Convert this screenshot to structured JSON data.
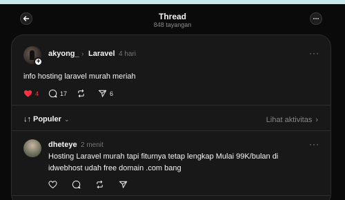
{
  "header": {
    "title": "Thread",
    "views": "848 tayangan",
    "back_icon": "arrow-left-icon",
    "more_icon": "more-horizontal-icon"
  },
  "post": {
    "username": "akyong_",
    "community": "Laravel",
    "time": "4 hari",
    "text": "info hosting laravel murah meriah",
    "likes": "4",
    "comments": "17",
    "shares": "6",
    "liked": true
  },
  "sort": {
    "label": "Populer",
    "activity_label": "Lihat aktivitas"
  },
  "reply": {
    "username": "dheteye",
    "time": "2 menit",
    "text": "Hosting Laravel murah tapi fiturnya tetap lengkap Mulai 99K/bulan di idwebhost udah free domain .com bang"
  },
  "colors": {
    "like_red": "#ff3040",
    "background": "#0a0a0a",
    "card": "#181818"
  }
}
